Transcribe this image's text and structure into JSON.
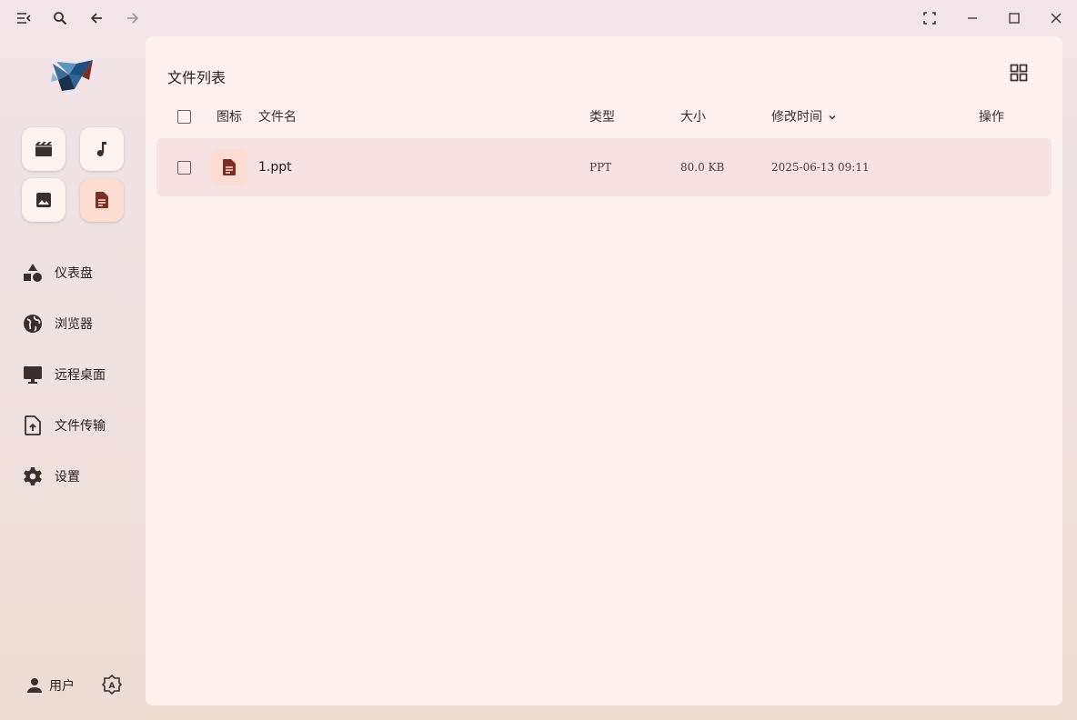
{
  "titlebar": {
    "menu_icon": "menu-collapse-icon",
    "search_icon": "search-icon",
    "back_icon": "arrow-left-icon",
    "forward_icon": "arrow-right-icon",
    "fullscreen_icon": "fullscreen-icon",
    "minimize_icon": "minimize-icon",
    "maximize_icon": "maximize-icon",
    "close_icon": "close-icon"
  },
  "sidebar": {
    "logo_icon": "origami-bird-logo",
    "quick_actions": [
      {
        "icon": "movie-icon"
      },
      {
        "icon": "music-note-icon"
      },
      {
        "icon": "image-icon"
      },
      {
        "icon": "document-icon",
        "active": true
      }
    ],
    "nav": [
      {
        "label": "仪表盘",
        "icon": "shapes-icon"
      },
      {
        "label": "浏览器",
        "icon": "globe-icon"
      },
      {
        "label": "远程桌面",
        "icon": "monitor-icon"
      },
      {
        "label": "文件传输",
        "icon": "file-upload-icon"
      },
      {
        "label": "设置",
        "icon": "gear-icon"
      }
    ],
    "user_label": "用户",
    "theme_icon": "auto-theme-icon"
  },
  "main": {
    "title": "文件列表",
    "view_toggle_icon": "grid-view-icon",
    "columns": {
      "icon": "图标",
      "name": "文件名",
      "type": "类型",
      "size": "大小",
      "modified": "修改时间",
      "actions": "操作"
    },
    "sort_icon": "chevron-down-icon",
    "files": [
      {
        "name": "1.ppt",
        "type": "PPT",
        "size": "80.0 KB",
        "modified": "2025-06-13 09:11",
        "icon": "document-icon"
      }
    ]
  },
  "colors": {
    "accent": "#7a2f25",
    "icon": "#3a2e2e",
    "panel": "#fff1ee",
    "row": "#f6e2e0",
    "active_chip": "#fddcd2"
  }
}
